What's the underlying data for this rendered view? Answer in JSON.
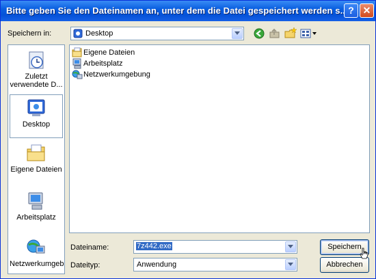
{
  "window": {
    "title": "Bitte geben Sie den Dateinamen an, unter dem die Datei gespeichert werden s...",
    "help_glyph": "?",
    "close_glyph": "✕"
  },
  "location": {
    "label": "Speichern in:",
    "value": "Desktop"
  },
  "toolbar": {
    "icons": [
      "back-icon",
      "up-folder-icon",
      "new-folder-icon",
      "view-menu-icon"
    ]
  },
  "places": [
    {
      "label": "Zuletzt verwendete D...",
      "icon": "recent-icon"
    },
    {
      "label": "Desktop",
      "icon": "desktop-icon",
      "selected": true
    },
    {
      "label": "Eigene Dateien",
      "icon": "my-documents-icon"
    },
    {
      "label": "Arbeitsplatz",
      "icon": "my-computer-icon"
    },
    {
      "label": "Netzwerkumgeb",
      "icon": "network-icon"
    }
  ],
  "files": [
    {
      "name": "Eigene Dateien",
      "icon": "folder-icon"
    },
    {
      "name": "Arbeitsplatz",
      "icon": "computer-icon"
    },
    {
      "name": "Netzwerkumgebung",
      "icon": "network-icon"
    }
  ],
  "filename": {
    "label": "Dateiname:",
    "value": "7z442.exe"
  },
  "filetype": {
    "label": "Dateityp:",
    "value": "Anwendung"
  },
  "buttons": {
    "save": "Speichern",
    "cancel": "Abbrechen"
  }
}
